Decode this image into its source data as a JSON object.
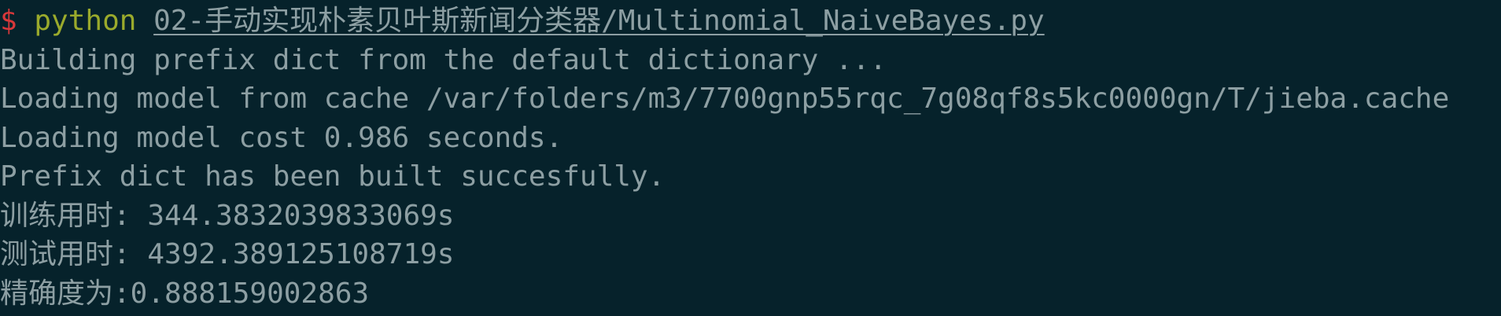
{
  "prompt": {
    "symbol": "$",
    "command": "python",
    "argument": "02-手动实现朴素贝叶斯新闻分类器/Multinomial_NaiveBayes.py"
  },
  "output_lines": [
    "Building prefix dict from the default dictionary ...",
    "Loading model from cache /var/folders/m3/7700gnp55rqc_7g08qf8s5kc0000gn/T/jieba.cache",
    "Loading model cost 0.986 seconds.",
    "Prefix dict has been built succesfully.",
    "训练用时: 344.3832039833069s",
    "测试用时: 4392.389125108719s",
    "精确度为:0.888159002863"
  ],
  "colors": {
    "background": "#06222b",
    "text": "#8d9fa3",
    "prompt_symbol": "#d8383a",
    "command": "#9aaa2c"
  }
}
